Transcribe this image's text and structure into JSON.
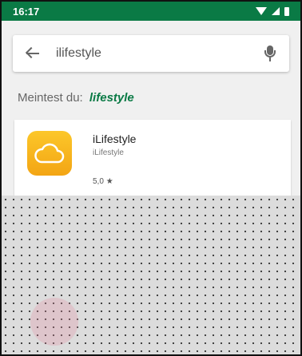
{
  "status_bar": {
    "time": "16:17",
    "icons": [
      "wifi-icon",
      "signal-icon",
      "battery-icon"
    ]
  },
  "search": {
    "value": "ilifestyle"
  },
  "suggestion": {
    "prefix": "Meintest du:",
    "term": "lifestyle"
  },
  "app": {
    "name": "iLifestyle",
    "developer": "iLifestyle",
    "rating": "5,0",
    "rating_icon": "star-icon"
  },
  "colors": {
    "accent": "#0a7a45",
    "app_icon": "#f7b11d"
  }
}
